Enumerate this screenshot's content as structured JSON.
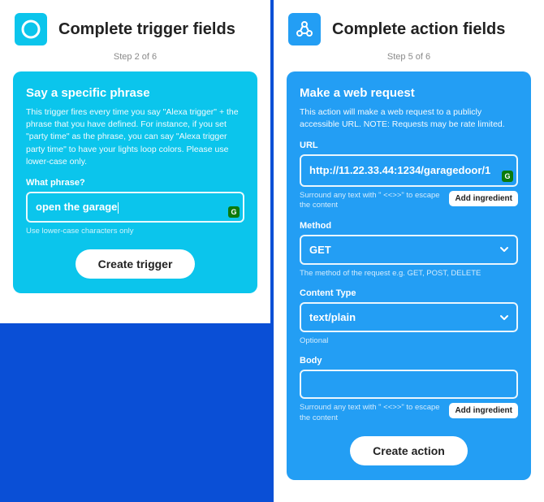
{
  "left": {
    "title": "Complete trigger fields",
    "step": "Step 2 of 6",
    "card": {
      "title": "Say a specific phrase",
      "desc": "This trigger fires every time you say \"Alexa trigger\" + the phrase that you have defined. For instance, if you set \"party time\" as the phrase, you can say \"Alexa trigger party time\" to have your lights loop colors. Please use lower-case only.",
      "field_label": "What phrase?",
      "field_value": "open the garage",
      "field_hint": "Use lower-case characters only",
      "submit": "Create trigger"
    }
  },
  "right": {
    "title": "Complete action fields",
    "step": "Step 5 of 6",
    "card": {
      "title": "Make a web request",
      "desc": "This action will make a web request to a publicly accessible URL. NOTE: Requests may be rate limited.",
      "url": {
        "label": "URL",
        "value": "http://11.22.33.44:1234/garagedoor/1",
        "hint": "Surround any text with \" <<>>\" to escape the content",
        "add": "Add ingredient"
      },
      "method": {
        "label": "Method",
        "value": "GET",
        "hint": "The method of the request e.g. GET, POST, DELETE"
      },
      "content_type": {
        "label": "Content Type",
        "value": "text/plain",
        "hint": "Optional"
      },
      "body": {
        "label": "Body",
        "value": "",
        "hint": "Surround any text with \" <<>>\" to escape the content",
        "add": "Add ingredient"
      },
      "submit": "Create action"
    }
  }
}
